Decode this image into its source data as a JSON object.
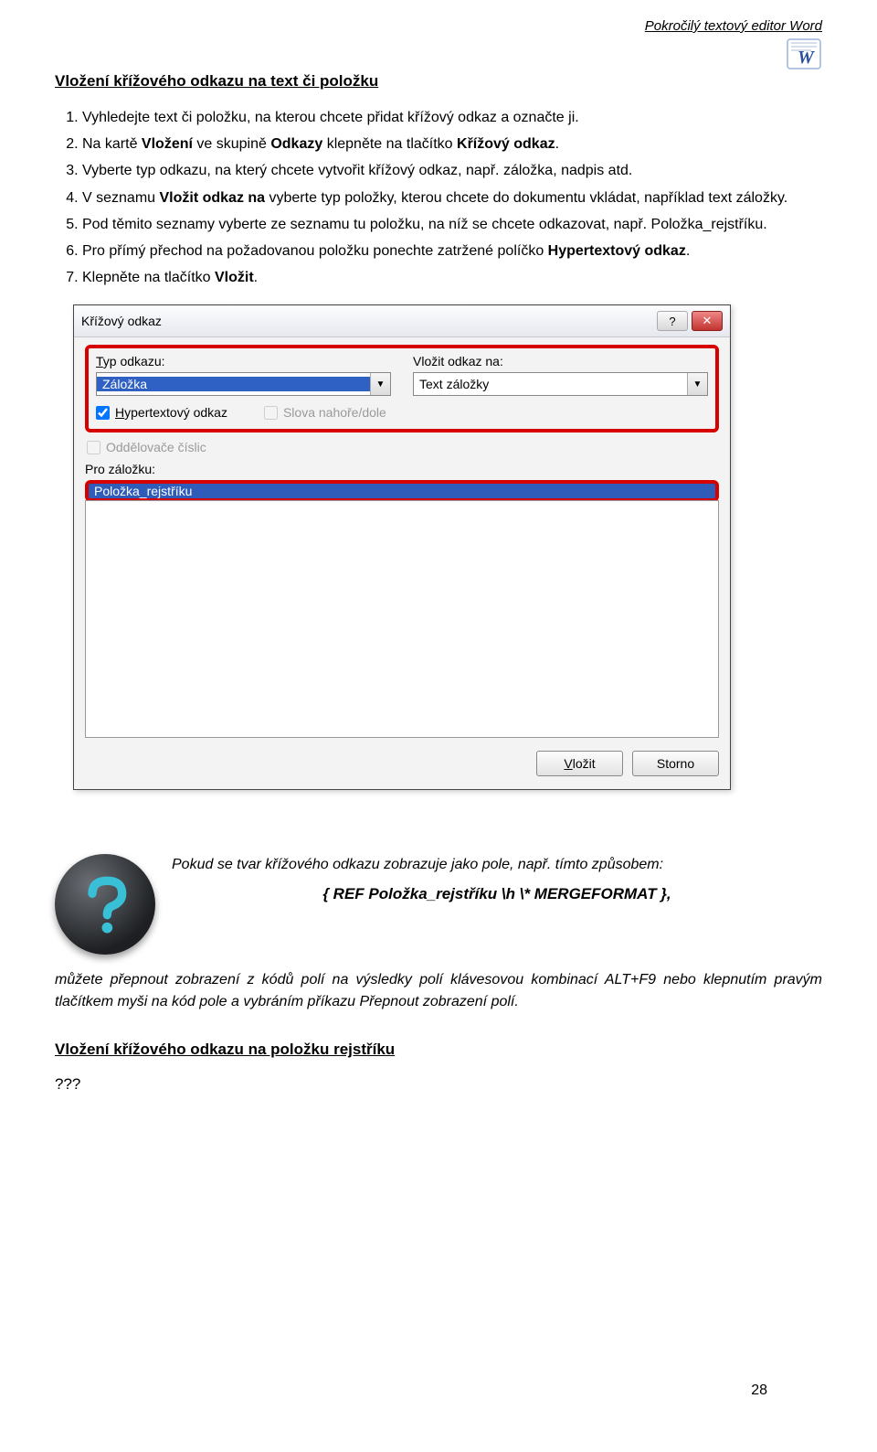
{
  "header": {
    "subtitle": "Pokročilý textový editor Word"
  },
  "section1": {
    "title": "Vložení křížového odkazu na text či položku",
    "steps": [
      "Vyhledejte text či položku, na kterou chcete přidat křížový odkaz a označte ji.",
      "Na kartě Vložení ve skupině Odkazy klepněte na tlačítko Křížový odkaz.",
      "Vyberte typ odkazu, na který chcete vytvořit křížový odkaz, např. záložka, nadpis atd.",
      "V seznamu Vložit odkaz na vyberte typ položky, kterou chcete do dokumentu vkládat, například text záložky.",
      "Pod těmito seznamy vyberte ze seznamu tu položku, na níž se chcete odkazovat, např. Položka_rejstříku.",
      "Pro přímý přechod na požadovanou položku ponechte zatržené políčko Hypertextový odkaz.",
      "Klepněte na tlačítko Vložit."
    ]
  },
  "dialog": {
    "title": "Křížový odkaz",
    "type_label_prefix": "T",
    "type_label_rest": "yp odkazu:",
    "insert_label": "Vložit odkaz na:",
    "type_value": "Záložka",
    "insert_value": "Text záložky",
    "hyper_prefix": "H",
    "hyper_rest": "ypertextový odkaz",
    "slova_label": "Slova nahoře/dole",
    "oddel_label": "Oddělovače číslic",
    "pro_label": "Pro záložku:",
    "list_item": "Položka_rejstříku",
    "btn_insert_prefix": "V",
    "btn_insert_rest": "ložit",
    "btn_cancel": "Storno"
  },
  "tip": {
    "line1": "Pokud se tvar křížového odkazu zobrazuje jako pole, např. tímto způsobem:",
    "field_code": "{ REF Položka_rejstříku \\h  \\* MERGEFORMAT },",
    "line2": "můžete přepnout zobrazení z kódů polí na výsledky polí klávesovou kombinací ALT+F9 nebo klepnutím pravým tlačítkem myši na kód pole a vybráním příkazu Přepnout zobrazení polí."
  },
  "section2": {
    "title": "Vložení křížového odkazu na položku rejstříku",
    "qmarks": "???"
  },
  "page_number": "28"
}
